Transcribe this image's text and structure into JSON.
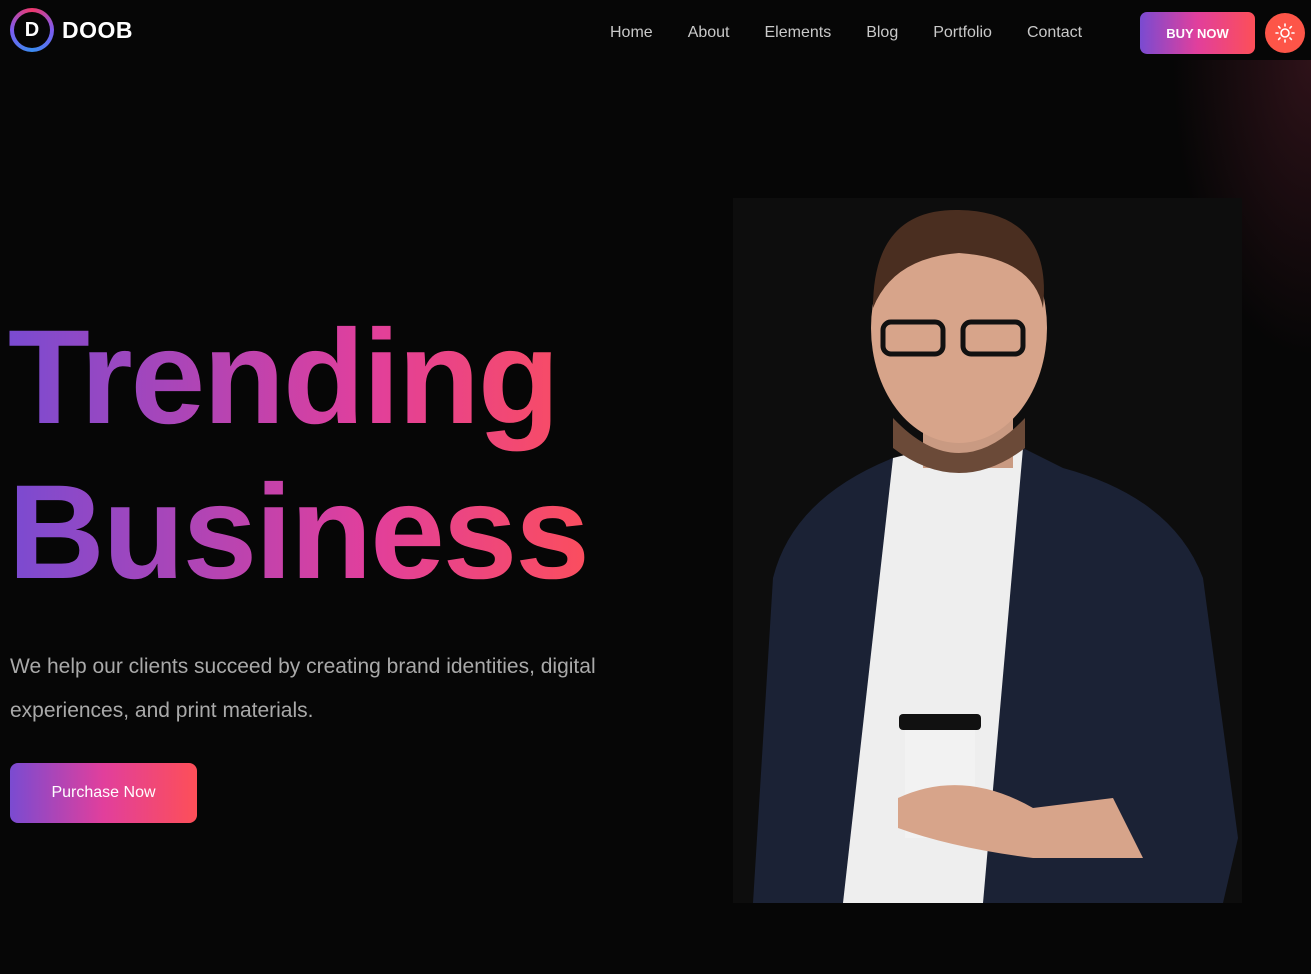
{
  "brand": {
    "name": "DOOB",
    "logo_letter": "D"
  },
  "nav": {
    "items": [
      "Home",
      "About",
      "Elements",
      "Blog",
      "Portfolio",
      "Contact"
    ]
  },
  "header": {
    "buy_label": "BUY NOW",
    "theme_icon": "sun-icon"
  },
  "hero": {
    "title_line1": "Trending",
    "title_line2": "Business",
    "description": "We help our clients succeed by creating brand identities, digital experiences, and print materials.",
    "cta_label": "Purchase Now"
  },
  "colors": {
    "gradient_start": "#7a4bd1",
    "gradient_mid": "#e13f9c",
    "gradient_end": "#fd4f58",
    "theme_button": "#fd5548"
  }
}
